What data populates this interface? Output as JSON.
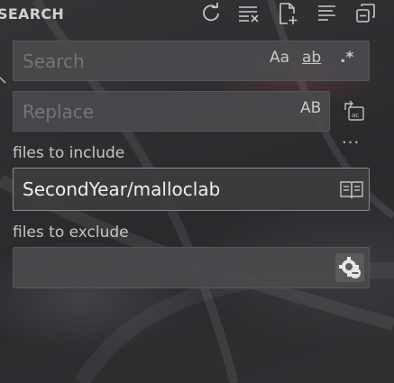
{
  "panel": {
    "title": "SEARCH"
  },
  "header_icons": [
    "refresh-icon",
    "clear-results-icon",
    "new-search-editor-icon",
    "view-as-tree-icon",
    "collapse-all-icon"
  ],
  "search": {
    "placeholder": "Search",
    "value": "",
    "match_case": "Aa",
    "whole_word": "ab",
    "regex": ".*"
  },
  "replace": {
    "placeholder": "Replace",
    "value": "",
    "preserve_case": "AB",
    "replace_all_icon": "replace-all-icon"
  },
  "more_options": "...",
  "include": {
    "label": "files to include",
    "value": "SecondYear/malloclab",
    "toggle_icon": "book-icon"
  },
  "exclude": {
    "label": "files to exclude",
    "value": "",
    "toggle_icon": "gear-exclude-icon"
  }
}
